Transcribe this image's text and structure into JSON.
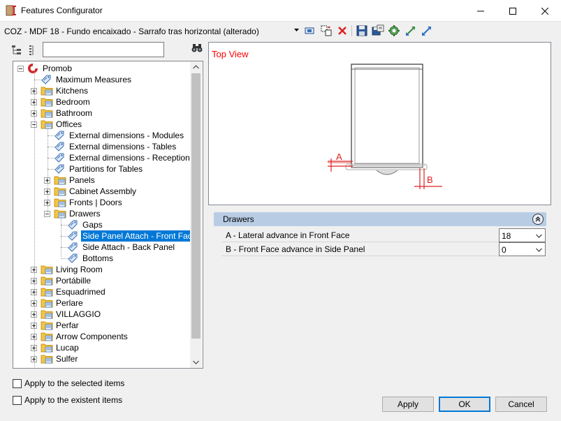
{
  "window": {
    "title": "Features Configurator",
    "minimize_icon": "minimize-icon",
    "maximize_icon": "maximize-icon",
    "close_icon": "close-icon"
  },
  "toolbar": {
    "item_name": "COZ - MDF 18 - Fundo encaixado - Sarrafo tras horizontal (alterado)",
    "icons": [
      "dropdown-arrow-icon",
      "select-item-icon",
      "copy-icon",
      "delete-icon",
      "save-icon",
      "save-as-icon",
      "settings-icon",
      "expand-icon",
      "collapse-icon"
    ]
  },
  "tree_panel": {
    "search_placeholder": "",
    "search_value": "",
    "items": [
      {
        "label": "Promob",
        "level": 0,
        "kind": "root",
        "expanded": true
      },
      {
        "label": "Maximum Measures",
        "level": 1,
        "kind": "leaf"
      },
      {
        "label": "Kitchens",
        "level": 1,
        "kind": "folder",
        "expanded": false
      },
      {
        "label": "Bedroom",
        "level": 1,
        "kind": "folder",
        "expanded": false
      },
      {
        "label": "Bathroom",
        "level": 1,
        "kind": "folder",
        "expanded": false
      },
      {
        "label": "Offices",
        "level": 1,
        "kind": "folder",
        "expanded": true
      },
      {
        "label": "External dimensions - Modules",
        "level": 2,
        "kind": "leaf"
      },
      {
        "label": "External dimensions - Tables",
        "level": 2,
        "kind": "leaf"
      },
      {
        "label": "External dimensions - Reception",
        "level": 2,
        "kind": "leaf"
      },
      {
        "label": "Partitions for Tables",
        "level": 2,
        "kind": "leaf"
      },
      {
        "label": "Panels",
        "level": 2,
        "kind": "folder",
        "expanded": false
      },
      {
        "label": "Cabinet Assembly",
        "level": 2,
        "kind": "folder",
        "expanded": false
      },
      {
        "label": "Fronts | Doors",
        "level": 2,
        "kind": "folder",
        "expanded": false
      },
      {
        "label": "Drawers",
        "level": 2,
        "kind": "folder",
        "expanded": true
      },
      {
        "label": "Gaps",
        "level": 3,
        "kind": "leaf"
      },
      {
        "label": "Side Panel Attach - Front Face",
        "level": 3,
        "kind": "leaf",
        "selected": true
      },
      {
        "label": "Side Attach - Back Panel",
        "level": 3,
        "kind": "leaf"
      },
      {
        "label": "Bottoms",
        "level": 3,
        "kind": "leaf"
      },
      {
        "label": "Living Room",
        "level": 1,
        "kind": "folder",
        "expanded": false
      },
      {
        "label": "Portábille",
        "level": 1,
        "kind": "folder",
        "expanded": false
      },
      {
        "label": "Esquadrimed",
        "level": 1,
        "kind": "folder",
        "expanded": false
      },
      {
        "label": "Perlare",
        "level": 1,
        "kind": "folder",
        "expanded": false
      },
      {
        "label": "VILLAGGIO",
        "level": 1,
        "kind": "folder",
        "expanded": false
      },
      {
        "label": "Perfar",
        "level": 1,
        "kind": "folder",
        "expanded": false
      },
      {
        "label": "Arrow Components",
        "level": 1,
        "kind": "folder",
        "expanded": false
      },
      {
        "label": "Lucap",
        "level": 1,
        "kind": "folder",
        "expanded": false
      },
      {
        "label": "Sulfer",
        "level": 1,
        "kind": "folder",
        "expanded": false
      }
    ]
  },
  "checkboxes": {
    "selected_items": {
      "label": "Apply to the selected items",
      "checked": false
    },
    "existent_items": {
      "label": "Apply to the existent items",
      "checked": false
    }
  },
  "preview": {
    "title": "Top View",
    "label_a": "A",
    "label_b": "B"
  },
  "properties": {
    "group_title": "Drawers",
    "rows": [
      {
        "label": "A - Lateral advance in Front Face",
        "value": "18"
      },
      {
        "label": "B - Front Face advance in Side Panel",
        "value": "0"
      }
    ]
  },
  "buttons": {
    "apply": "Apply",
    "ok": "OK",
    "cancel": "Cancel"
  },
  "colors": {
    "selection": "#0078d7",
    "preview_accent": "#ff0000",
    "group_header": "#b8cce4"
  }
}
